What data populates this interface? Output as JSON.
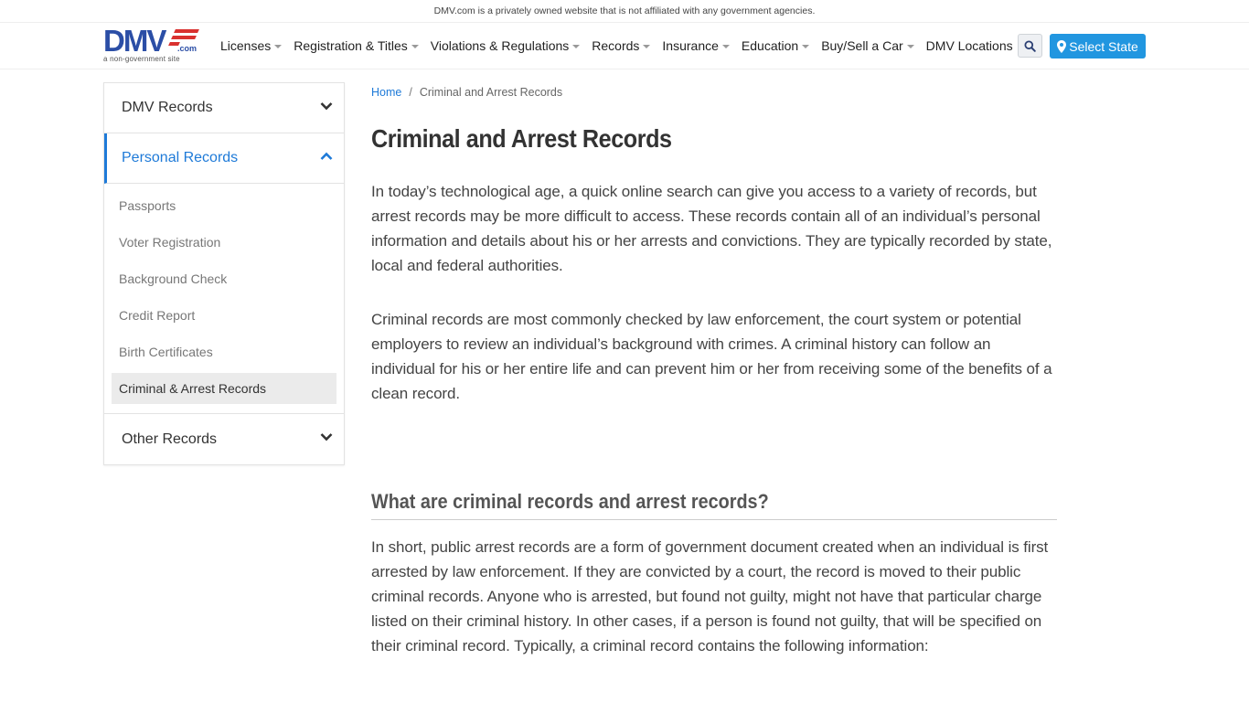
{
  "topbar": {
    "disclaimer": "DMV.com is a privately owned website that is not affiliated with any government agencies."
  },
  "logo": {
    "main": "DMV",
    "suffix": ".com",
    "tagline": "a non-government site"
  },
  "nav": {
    "items": [
      {
        "label": "Licenses",
        "dropdown": true
      },
      {
        "label": "Registration & Titles",
        "dropdown": true
      },
      {
        "label": "Violations & Regulations",
        "dropdown": true
      },
      {
        "label": "Records",
        "dropdown": true
      },
      {
        "label": "Insurance",
        "dropdown": true
      },
      {
        "label": "Education",
        "dropdown": true
      },
      {
        "label": "Buy/Sell a Car",
        "dropdown": true
      },
      {
        "label": "DMV Locations",
        "dropdown": false
      }
    ],
    "search_icon": "search-icon",
    "select_state_label": "Select State",
    "select_state_icon": "map-marker-icon"
  },
  "colors": {
    "accent": "#1e7ad8",
    "button": "#2196e0",
    "logo_blue": "#2b4ea6",
    "logo_red": "#d9312f"
  },
  "sidebar": {
    "sections": [
      {
        "label": "DMV Records",
        "expanded": false
      },
      {
        "label": "Personal Records",
        "expanded": true,
        "items": [
          {
            "label": "Passports"
          },
          {
            "label": "Voter Registration"
          },
          {
            "label": "Background Check"
          },
          {
            "label": "Credit Report"
          },
          {
            "label": "Birth Certificates"
          },
          {
            "label": "Criminal & Arrest Records",
            "current": true
          }
        ]
      },
      {
        "label": "Other Records",
        "expanded": false
      }
    ]
  },
  "breadcrumb": {
    "home": "Home",
    "separator": "/",
    "current": "Criminal and Arrest Records"
  },
  "article": {
    "title": "Criminal and Arrest Records",
    "paragraphs": [
      "In today’s technological age, a quick online search can give you access to a variety of records, but arrest records may be more difficult to access. These records contain all of an individual’s personal information and details about his or her arrests and convictions. They are typically recorded by state, local and federal authorities.",
      "Criminal records are most commonly checked by law enforcement, the court system or potential employers to review an individual’s background with crimes. A criminal history can follow an individual for his or her entire life and can prevent him or her from receiving some of the benefits of a clean record."
    ],
    "section_heading": "What are criminal records and arrest records?",
    "section_paragraph": "In short, public arrest records are a form of government document created when an individual is first arrested by law enforcement. If they are convicted by a court, the record is moved to their public criminal records. Anyone who is arrested, but found not guilty, might not have that particular charge listed on their criminal history. In other cases, if a person is found not guilty, that will be specified on their criminal record. Typically, a criminal record contains the following information:"
  }
}
